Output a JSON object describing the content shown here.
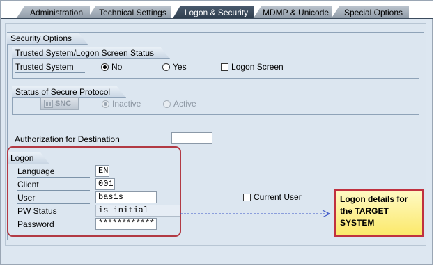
{
  "tabs": [
    {
      "label": "Administration",
      "active": false
    },
    {
      "label": "Technical Settings",
      "active": false
    },
    {
      "label": "Logon & Security",
      "active": true
    },
    {
      "label": "MDMP & Unicode",
      "active": false
    },
    {
      "label": "Special Options",
      "active": false
    }
  ],
  "security_options": {
    "title": "Security Options",
    "trusted": {
      "title": "Trusted System/Logon Screen Status",
      "label": "Trusted System",
      "no_label": "No",
      "yes_label": "Yes",
      "selected": "No",
      "logon_screen_label": "Logon Screen",
      "logon_screen_checked": false
    },
    "secure_protocol": {
      "title": "Status of Secure Protocol",
      "snc_button": "SNC",
      "inactive_label": "Inactive",
      "active_label": "Active",
      "selected": "Inactive"
    },
    "authorization_label": "Authorization for Destination",
    "authorization_value": ""
  },
  "logon": {
    "title": "Logon",
    "language_label": "Language",
    "language_value": "EN",
    "client_label": "Client",
    "client_value": "001",
    "user_label": "User",
    "user_value": "basis",
    "pw_status_label": "PW Status",
    "pw_status_value": "is initial",
    "password_label": "Password",
    "password_value": "************",
    "current_user_label": "Current User",
    "current_user_checked": false
  },
  "callout": {
    "lines": [
      "Logon details for",
      "the TARGET",
      "SYSTEM"
    ]
  },
  "colors": {
    "highlight_border": "#b23a44",
    "callout_fill": "#fcef8a",
    "arrow": "#3a55c8"
  }
}
